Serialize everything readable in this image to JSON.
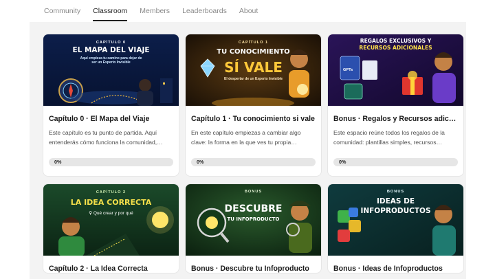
{
  "tabs": [
    {
      "label": "Community"
    },
    {
      "label": "Classroom",
      "active": true
    },
    {
      "label": "Members"
    },
    {
      "label": "Leaderboards"
    },
    {
      "label": "About"
    }
  ],
  "cards": [
    {
      "title": "Capítulo 0 · El Mapa del Viaje",
      "description": "Este capítulo es tu punto de partida. Aquí entenderás cómo funciona la comunidad,…",
      "progress": 0,
      "progress_label": "0%",
      "thumb": {
        "kicker": "CAPÍTULO 0",
        "heading": "EL MAPA DEL VIAJE",
        "subtitle": "Aquí empieza tu camino para dejar de ser un Experto Invisible",
        "accent": "#7fd0ff"
      }
    },
    {
      "title": "Capítulo 1 · Tu conocimiento si vale",
      "description": "En este capítulo empiezas a cambiar algo clave: la forma en la que ves tu propia…",
      "progress": 0,
      "progress_label": "0%",
      "thumb": {
        "kicker": "CAPÍTULO 1",
        "heading_1": "TU CONOCIMIENTO",
        "heading_2": "SÍ VALE",
        "subtitle": "El despertar de un Experto Invisible",
        "accent": "#ffc83a"
      }
    },
    {
      "title": "Bonus · Regalos y Recursos adicionales",
      "description": "Este espacio reúne todos los regalos de la comunidad: plantillas simples, recursos…",
      "progress": 0,
      "progress_label": "0%",
      "thumb": {
        "heading_1": "REGALOS EXCLUSIVOS Y",
        "heading_2": "RECURSOS ADICIONALES",
        "badge": "GPTs",
        "accent": "#ffe14a"
      }
    },
    {
      "title": "Capítulo 2 · La Idea Correcta",
      "thumb": {
        "kicker": "CAPÍTULO 2",
        "heading": "LA IDEA CORRECTA",
        "subtitle": "Qué crear y por qué",
        "accent": "#f5e04a"
      }
    },
    {
      "title": "Bonus · Descubre tu Infoproducto",
      "thumb": {
        "kicker": "BONUS",
        "heading_1": "DESCUBRE",
        "heading_2": "TU INFOPRODUCTO",
        "accent": "#ffffff"
      }
    },
    {
      "title": "Bonus · Ideas de Infoproductos",
      "thumb": {
        "kicker": "BONUS",
        "heading_1": "IDEAS DE",
        "heading_2": "INFOPRODUCTOS",
        "accent": "#ffffff"
      }
    }
  ],
  "colors": {
    "active_tab": "#1f1f1f",
    "inactive_tab": "#8a8a8a",
    "content_bg": "#f3f3f3",
    "card_bg": "#ffffff"
  }
}
